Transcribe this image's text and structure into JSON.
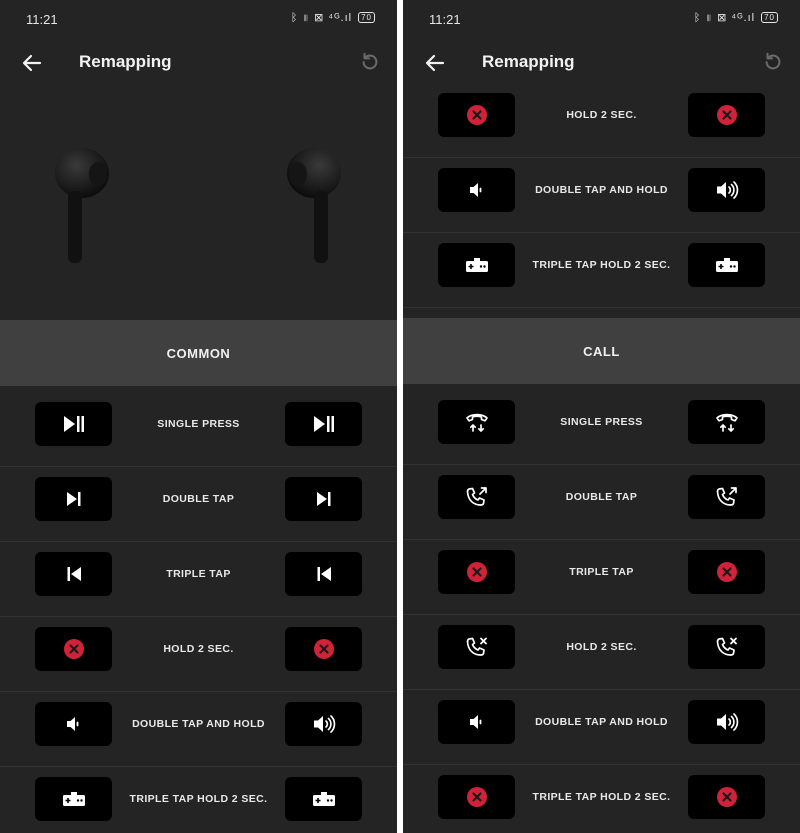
{
  "status_bar": {
    "time": "11:21",
    "icons_text": "ᛒ ⫴ ⊠ ⁴ᴳ.ıl",
    "battery": "70"
  },
  "app_bar": {
    "title": "Remapping",
    "back_icon": "arrow-left-icon",
    "reset_icon": "reset-icon"
  },
  "colors": {
    "background": "#242424",
    "section_header": "#404040",
    "button_bg": "#000000",
    "disabled_red": "#d0233a"
  },
  "left_panel": {
    "section": "COMMON",
    "rows": [
      {
        "label": "SINGLE PRESS",
        "left_icon": "play-pause-icon",
        "right_icon": "play-pause-icon"
      },
      {
        "label": "DOUBLE TAP",
        "left_icon": "next-track-icon",
        "right_icon": "next-track-icon"
      },
      {
        "label": "TRIPLE TAP",
        "left_icon": "previous-track-icon",
        "right_icon": "previous-track-icon"
      },
      {
        "label": "HOLD 2 SEC.",
        "left_icon": "disabled-icon",
        "right_icon": "disabled-icon"
      },
      {
        "label": "DOUBLE TAP AND HOLD",
        "left_icon": "volume-down-icon",
        "right_icon": "volume-up-icon"
      },
      {
        "label": "TRIPLE TAP HOLD 2 SEC.",
        "left_icon": "gaming-mode-icon",
        "right_icon": "gaming-mode-icon"
      }
    ]
  },
  "right_panel": {
    "top_rows": [
      {
        "label": "HOLD 2 SEC.",
        "left_icon": "disabled-icon",
        "right_icon": "disabled-icon"
      },
      {
        "label": "DOUBLE TAP AND HOLD",
        "left_icon": "volume-down-icon",
        "right_icon": "volume-up-icon"
      },
      {
        "label": "TRIPLE TAP HOLD 2 SEC.",
        "left_icon": "gaming-mode-icon",
        "right_icon": "gaming-mode-icon"
      }
    ],
    "section": "CALL",
    "rows": [
      {
        "label": "SINGLE PRESS",
        "left_icon": "answer-end-call-icon",
        "right_icon": "answer-end-call-icon"
      },
      {
        "label": "DOUBLE TAP",
        "left_icon": "call-transfer-icon",
        "right_icon": "call-transfer-icon"
      },
      {
        "label": "TRIPLE TAP",
        "left_icon": "disabled-icon",
        "right_icon": "disabled-icon"
      },
      {
        "label": "HOLD 2 SEC.",
        "left_icon": "reject-call-icon",
        "right_icon": "reject-call-icon"
      },
      {
        "label": "DOUBLE TAP AND HOLD",
        "left_icon": "volume-down-icon",
        "right_icon": "volume-up-icon"
      },
      {
        "label": "TRIPLE TAP HOLD 2 SEC.",
        "left_icon": "disabled-icon",
        "right_icon": "disabled-icon"
      }
    ]
  }
}
